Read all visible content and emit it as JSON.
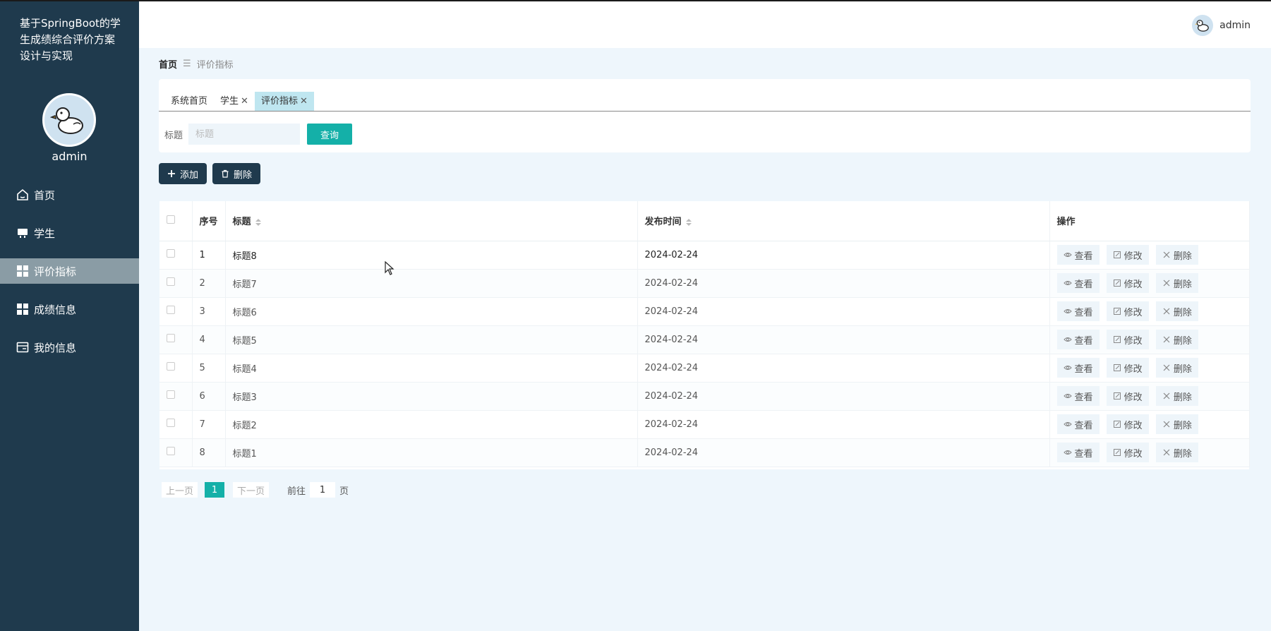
{
  "sidebar": {
    "brand": "基于SpringBoot的学生成绩综合评价方案设计与实现",
    "username": "admin",
    "menu": [
      {
        "label": "首页",
        "icon": "home-icon"
      },
      {
        "label": "学生",
        "icon": "student-icon"
      },
      {
        "label": "评价指标",
        "icon": "grid-icon",
        "active": true
      },
      {
        "label": "成绩信息",
        "icon": "grid-icon"
      },
      {
        "label": "我的信息",
        "icon": "card-icon"
      }
    ]
  },
  "header": {
    "username": "admin"
  },
  "breadcrumb": {
    "home": "首页",
    "current": "评价指标"
  },
  "tabs": [
    {
      "label": "系统首页",
      "closable": false
    },
    {
      "label": "学生",
      "closable": true
    },
    {
      "label": "评价指标",
      "closable": true,
      "active": true
    }
  ],
  "search": {
    "label": "标题",
    "placeholder": "标题",
    "button": "查询"
  },
  "actions": {
    "add": "添加",
    "delete": "删除"
  },
  "table": {
    "headers": {
      "index": "序号",
      "title": "标题",
      "time": "发布时间",
      "ops": "操作"
    },
    "op_labels": {
      "view": "查看",
      "edit": "修改",
      "delete": "删除"
    },
    "rows": [
      {
        "index": "1",
        "title": "标题8",
        "time": "2024-02-24"
      },
      {
        "index": "2",
        "title": "标题7",
        "time": "2024-02-24"
      },
      {
        "index": "3",
        "title": "标题6",
        "time": "2024-02-24"
      },
      {
        "index": "4",
        "title": "标题5",
        "time": "2024-02-24"
      },
      {
        "index": "5",
        "title": "标题4",
        "time": "2024-02-24"
      },
      {
        "index": "6",
        "title": "标题3",
        "time": "2024-02-24"
      },
      {
        "index": "7",
        "title": "标题2",
        "time": "2024-02-24"
      },
      {
        "index": "8",
        "title": "标题1",
        "time": "2024-02-24"
      }
    ]
  },
  "pagination": {
    "prev": "上一页",
    "current": "1",
    "next": "下一页",
    "goto": "前往",
    "goto_value": "1",
    "page_suffix": "页"
  },
  "colors": {
    "sidebar": "#1f3a4d",
    "accent": "#14b0a8",
    "active_tab": "#bfe6f0",
    "background": "#eef6fc"
  }
}
